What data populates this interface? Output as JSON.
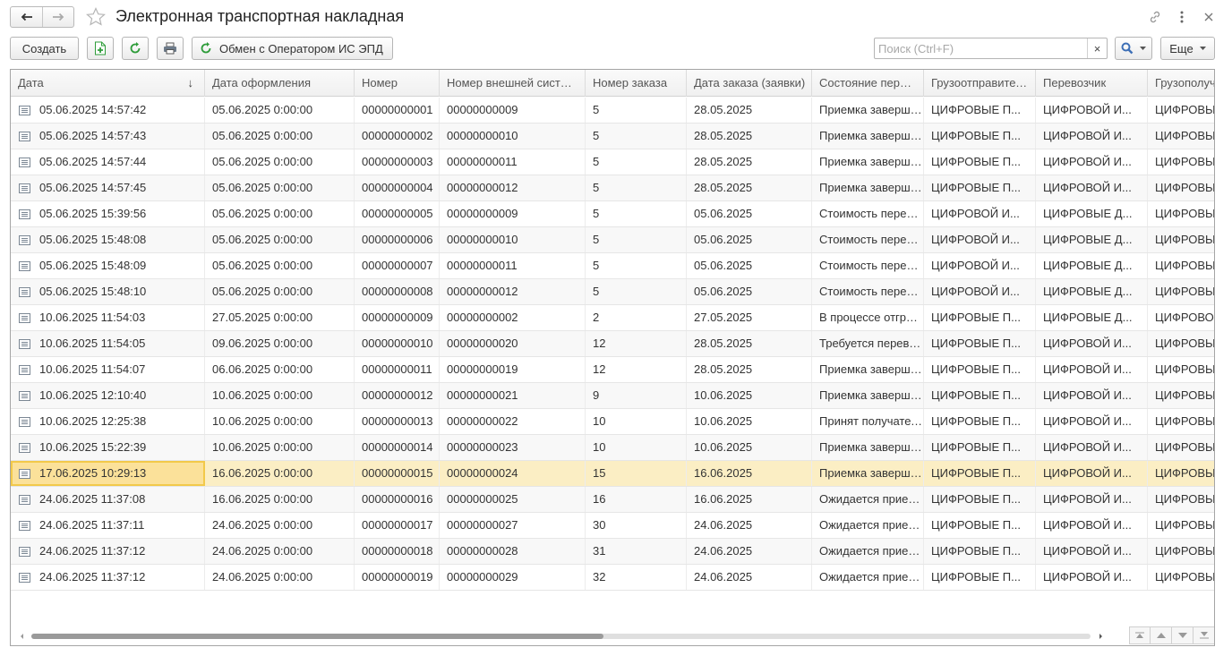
{
  "window": {
    "title": "Электронная транспортная накладная",
    "icons": [
      "arrow-left-icon",
      "arrow-right-icon",
      "star-icon",
      "link-icon",
      "more-vertical-icon",
      "close-icon"
    ]
  },
  "toolbar": {
    "create_label": "Создать",
    "exchange_label": "Обмен с Оператором ИС ЭПД",
    "search_placeholder": "Поиск (Ctrl+F)",
    "search_clear": "×",
    "more_label": "Еще"
  },
  "colors": {
    "selected_row": "#fbeec4",
    "selected_cell_border": "#f2c94a",
    "green_icon": "#2e9c3a",
    "header_bg": "#f3f3f3"
  },
  "table": {
    "columns": [
      "Дата",
      "Дата оформления",
      "Номер",
      "Номер внешней системы",
      "Номер заказа",
      "Дата заказа (заявки)",
      "Состояние перевозки",
      "Грузоотправитель",
      "Перевозчик",
      "Грузополучатель"
    ],
    "sort_indicator": "↓",
    "selected_index": 14,
    "rows": [
      [
        "05.06.2025 14:57:42",
        "05.06.2025 0:00:00",
        "00000000001",
        "00000000009",
        "5",
        "28.05.2025",
        "Приемка завершена",
        "ЦИФРОВЫЕ П...",
        "ЦИФРОВОЙ И...",
        "ЦИФРОВЫЕ"
      ],
      [
        "05.06.2025 14:57:43",
        "05.06.2025 0:00:00",
        "00000000002",
        "00000000010",
        "5",
        "28.05.2025",
        "Приемка завершена",
        "ЦИФРОВЫЕ П...",
        "ЦИФРОВОЙ И...",
        "ЦИФРОВЫЕ"
      ],
      [
        "05.06.2025 14:57:44",
        "05.06.2025 0:00:00",
        "00000000003",
        "00000000011",
        "5",
        "28.05.2025",
        "Приемка завершена",
        "ЦИФРОВЫЕ П...",
        "ЦИФРОВОЙ И...",
        "ЦИФРОВЫЕ"
      ],
      [
        "05.06.2025 14:57:45",
        "05.06.2025 0:00:00",
        "00000000004",
        "00000000012",
        "5",
        "28.05.2025",
        "Приемка завершена",
        "ЦИФРОВЫЕ П...",
        "ЦИФРОВОЙ И...",
        "ЦИФРОВЫЕ"
      ],
      [
        "05.06.2025 15:39:56",
        "05.06.2025 0:00:00",
        "00000000005",
        "00000000009",
        "5",
        "05.06.2025",
        "Стоимость перевозки",
        "ЦИФРОВОЙ И...",
        "ЦИФРОВЫЕ Д...",
        "ЦИФРОВЫЕ"
      ],
      [
        "05.06.2025 15:48:08",
        "05.06.2025 0:00:00",
        "00000000006",
        "00000000010",
        "5",
        "05.06.2025",
        "Стоимость перевозки",
        "ЦИФРОВОЙ И...",
        "ЦИФРОВЫЕ Д...",
        "ЦИФРОВЫЕ"
      ],
      [
        "05.06.2025 15:48:09",
        "05.06.2025 0:00:00",
        "00000000007",
        "00000000011",
        "5",
        "05.06.2025",
        "Стоимость перевозки",
        "ЦИФРОВОЙ И...",
        "ЦИФРОВЫЕ Д...",
        "ЦИФРОВЫЕ"
      ],
      [
        "05.06.2025 15:48:10",
        "05.06.2025 0:00:00",
        "00000000008",
        "00000000012",
        "5",
        "05.06.2025",
        "Стоимость перевозки",
        "ЦИФРОВОЙ И...",
        "ЦИФРОВЫЕ Д...",
        "ЦИФРОВЫЕ"
      ],
      [
        "10.06.2025 11:54:03",
        "27.05.2025 0:00:00",
        "00000000009",
        "00000000002",
        "2",
        "27.05.2025",
        "В процессе отгрузки",
        "ЦИФРОВЫЕ П...",
        "ЦИФРОВЫЕ Д...",
        "ЦИФРОВОЕ"
      ],
      [
        "10.06.2025 11:54:05",
        "09.06.2025 0:00:00",
        "00000000010",
        "00000000020",
        "12",
        "28.05.2025",
        "Требуется перевозка",
        "ЦИФРОВЫЕ П...",
        "ЦИФРОВОЙ И...",
        "ЦИФРОВЫЕ"
      ],
      [
        "10.06.2025 11:54:07",
        "06.06.2025 0:00:00",
        "00000000011",
        "00000000019",
        "12",
        "28.05.2025",
        "Приемка завершена",
        "ЦИФРОВЫЕ П...",
        "ЦИФРОВОЙ И...",
        "ЦИФРОВЫЕ"
      ],
      [
        "10.06.2025 12:10:40",
        "10.06.2025 0:00:00",
        "00000000012",
        "00000000021",
        "9",
        "10.06.2025",
        "Приемка завершена",
        "ЦИФРОВЫЕ П...",
        "ЦИФРОВОЙ И...",
        "ЦИФРОВЫЕ"
      ],
      [
        "10.06.2025 12:25:38",
        "10.06.2025 0:00:00",
        "00000000013",
        "00000000022",
        "10",
        "10.06.2025",
        "Принят получателем",
        "ЦИФРОВЫЕ П...",
        "ЦИФРОВОЙ И...",
        "ЦИФРОВЫЕ"
      ],
      [
        "10.06.2025 15:22:39",
        "10.06.2025 0:00:00",
        "00000000014",
        "00000000023",
        "10",
        "10.06.2025",
        "Приемка завершена",
        "ЦИФРОВЫЕ П...",
        "ЦИФРОВОЙ И...",
        "ЦИФРОВЫЕ"
      ],
      [
        "17.06.2025 10:29:13",
        "16.06.2025 0:00:00",
        "00000000015",
        "00000000024",
        "15",
        "16.06.2025",
        "Приемка завершена",
        "ЦИФРОВЫЕ П...",
        "ЦИФРОВОЙ И...",
        "ЦИФРОВЫЕ"
      ],
      [
        "24.06.2025 11:37:08",
        "16.06.2025 0:00:00",
        "00000000016",
        "00000000025",
        "16",
        "16.06.2025",
        "Ожидается приемка",
        "ЦИФРОВЫЕ П...",
        "ЦИФРОВОЙ И...",
        "ЦИФРОВЫЕ"
      ],
      [
        "24.06.2025 11:37:11",
        "24.06.2025 0:00:00",
        "00000000017",
        "00000000027",
        "30",
        "24.06.2025",
        "Ожидается приемка",
        "ЦИФРОВЫЕ П...",
        "ЦИФРОВОЙ И...",
        "ЦИФРОВЫЕ"
      ],
      [
        "24.06.2025 11:37:12",
        "24.06.2025 0:00:00",
        "00000000018",
        "00000000028",
        "31",
        "24.06.2025",
        "Ожидается приемка",
        "ЦИФРОВЫЕ П...",
        "ЦИФРОВОЙ И...",
        "ЦИФРОВЫЕ"
      ],
      [
        "24.06.2025 11:37:12",
        "24.06.2025 0:00:00",
        "00000000019",
        "00000000029",
        "32",
        "24.06.2025",
        "Ожидается приемка",
        "ЦИФРОВЫЕ П...",
        "ЦИФРОВОЙ И...",
        "ЦИФРОВЫЕ"
      ]
    ]
  },
  "scroll": {
    "horizontal_visible_fraction": 0.54
  }
}
